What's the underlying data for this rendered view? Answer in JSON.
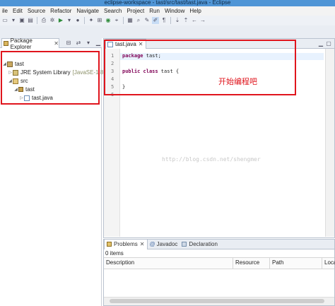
{
  "window": {
    "title": "eclipse-workspace - tast/src/tast/tast.java - Eclipse"
  },
  "menu": [
    "ile",
    "Edit",
    "Source",
    "Refactor",
    "Navigate",
    "Search",
    "Project",
    "Run",
    "Window",
    "Help"
  ],
  "package_explorer": {
    "tab_label": "Package Explorer",
    "tree": {
      "project": "tast",
      "jre_label": "JRE System Library",
      "jre_version": "[JavaSE-1.8]",
      "src": "src",
      "package": "tast",
      "file": "tast.java"
    }
  },
  "editor": {
    "tab_label": "tast.java",
    "line_numbers": [
      "1",
      "2",
      "3",
      "4",
      "5",
      "6"
    ],
    "lines": {
      "l1_keyword": "package",
      "l1_rest": " tast;",
      "l3_kw1": "public",
      "l3_kw2": "class",
      "l3_rest": " tast {",
      "l5": "}"
    },
    "watermark": "http://blog.csdn.net/shengmer"
  },
  "annotation": {
    "text": "开始编程吧",
    "color": "#e0151d"
  },
  "problems": {
    "tabs": [
      "Problems",
      "Javadoc",
      "Declaration"
    ],
    "items_count": "0 items",
    "columns": [
      "Description",
      "Resource",
      "Path",
      "Locat"
    ]
  },
  "colors": {
    "keyword": "#7f0055",
    "titlebar": "#4f95d6",
    "highlight": "#e0151d"
  }
}
